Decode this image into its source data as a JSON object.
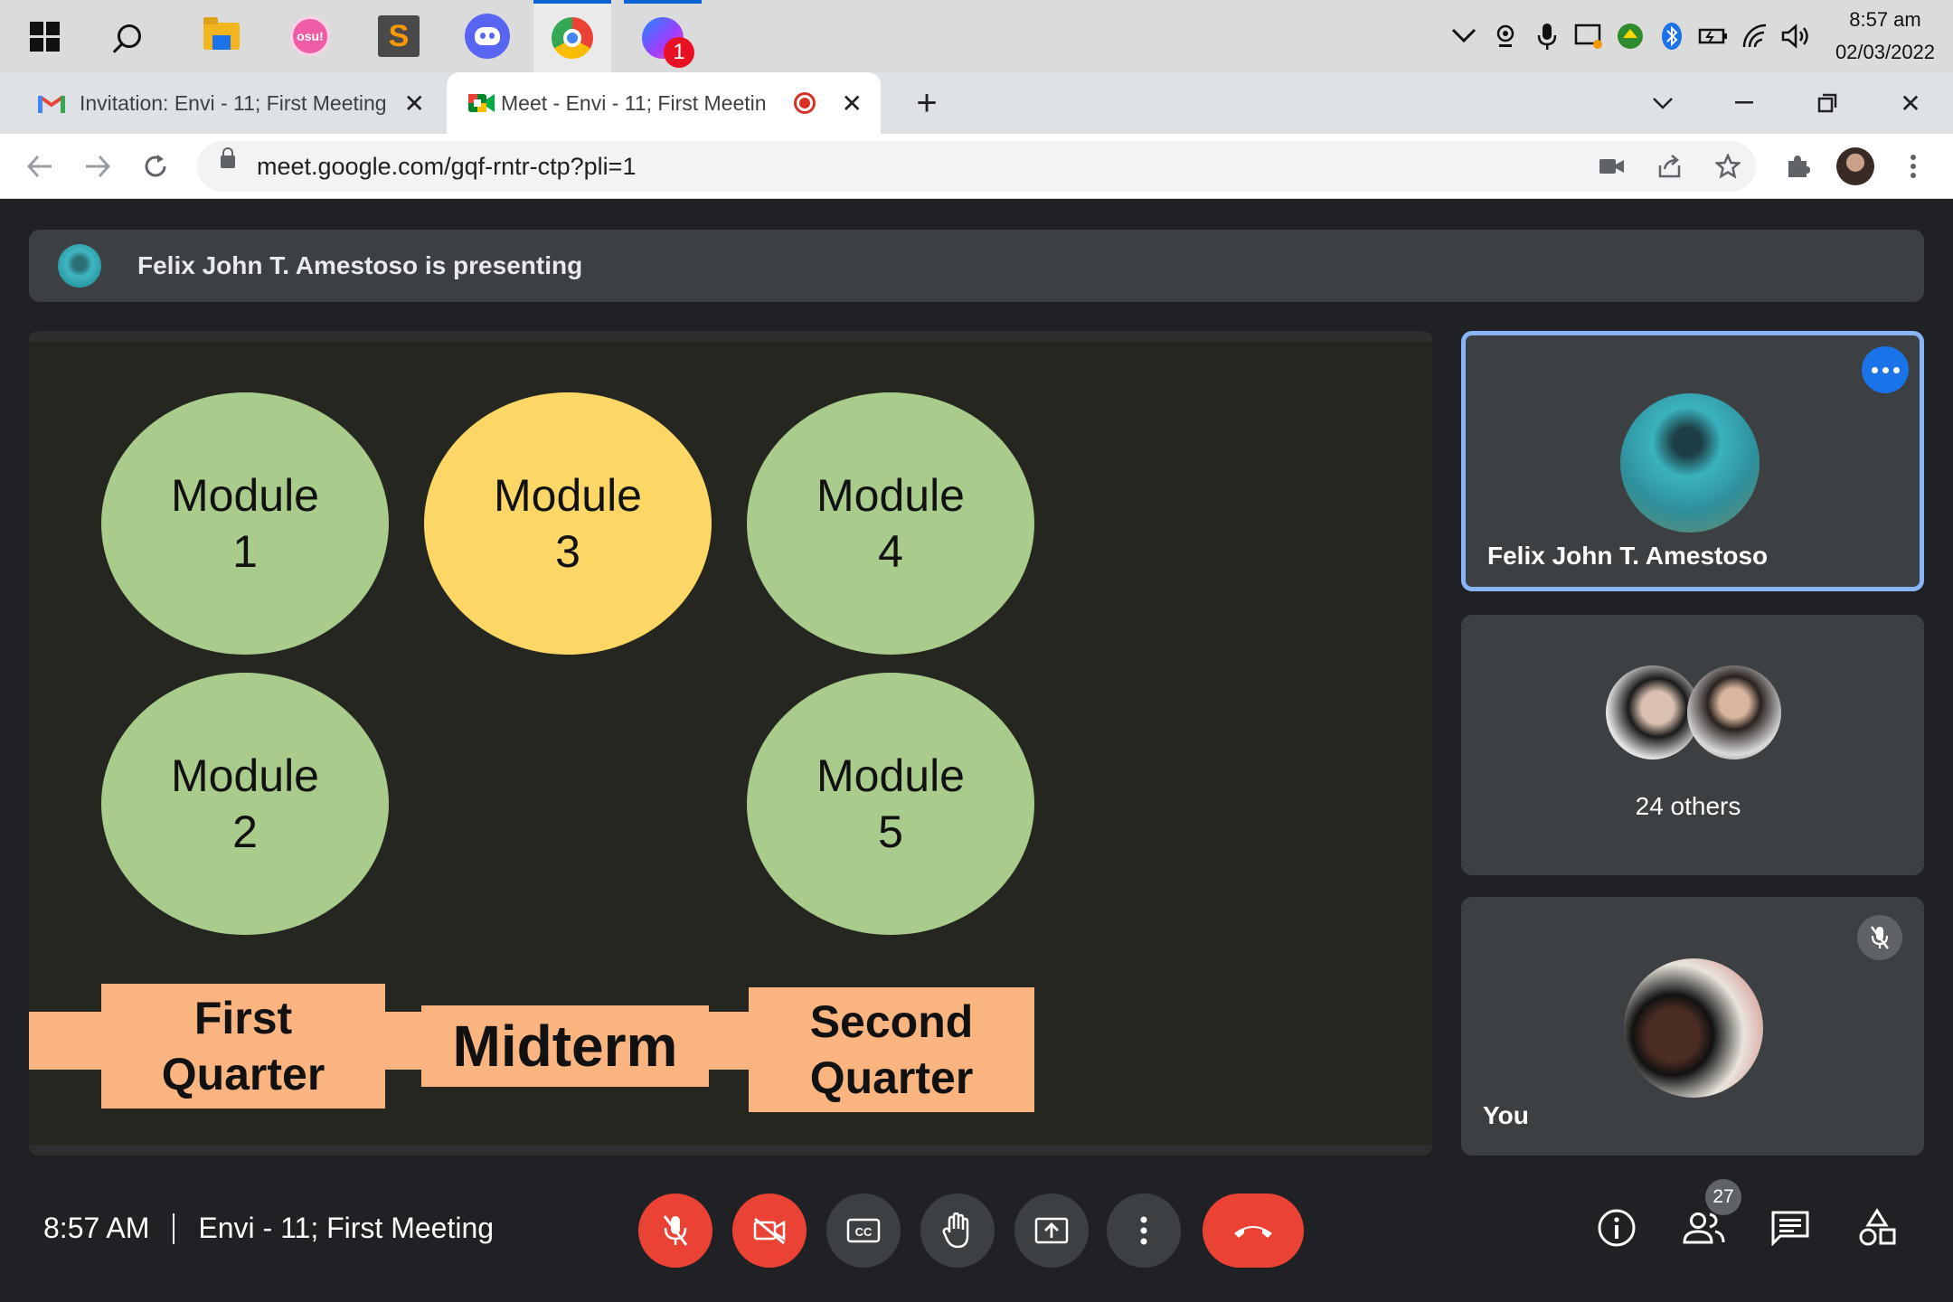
{
  "taskbar": {
    "apps": [
      "start",
      "search",
      "file-explorer",
      "osu",
      "sublime-text",
      "discord",
      "chrome",
      "messenger"
    ],
    "osu_label": "osu!",
    "messenger_badge": "1",
    "clock_time": "8:57 am",
    "clock_date": "02/03/2022"
  },
  "browser": {
    "tabs": [
      {
        "title": "Invitation: Envi - 11; First Meeting"
      },
      {
        "title": "Meet - Envi - 11; First Meetin"
      }
    ],
    "url": "meet.google.com/gqf-rntr-ctp?pli=1"
  },
  "meet": {
    "banner_text": "Felix John T. Amestoso is presenting",
    "slide": {
      "modules": [
        "Module\n1",
        "Module\n3",
        "Module\n4",
        "Module\n2",
        "Module\n5"
      ],
      "first_quarter": "First\nQuarter",
      "midterm": "Midterm",
      "second_quarter": "Second\nQuarter"
    },
    "tiles": {
      "presenter_name": "Felix John T. Amestoso",
      "others_label": "24 others",
      "self_label": "You"
    },
    "bottom": {
      "time": "8:57 AM",
      "meeting_name": "Envi - 11; First Meeting",
      "participant_count": "27"
    }
  },
  "colors": {
    "accent": "#1a73e8",
    "selected_border": "#8ab4f8",
    "danger": "#ea4335",
    "module_green": "#a9cc8d",
    "module_yellow": "#fdd765",
    "quarter_box": "#f9b480"
  }
}
